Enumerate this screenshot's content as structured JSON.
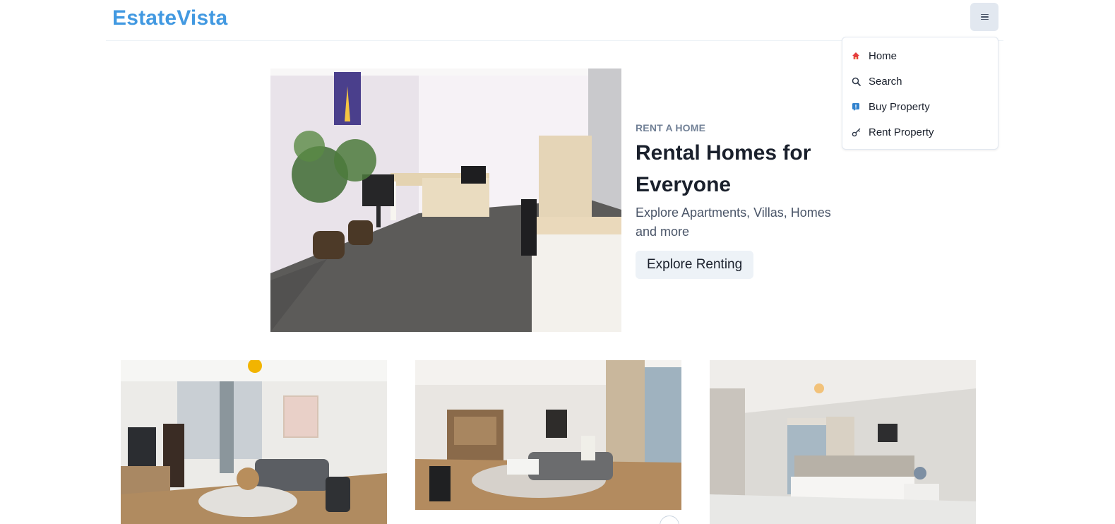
{
  "brand": {
    "name": "EstateVista",
    "color": "#4299e1"
  },
  "nav": {
    "menu_icon": "hamburger-icon",
    "items": [
      {
        "label": "Home",
        "icon": "home-icon"
      },
      {
        "label": "Search",
        "icon": "search-icon"
      },
      {
        "label": "Buy Property",
        "icon": "info-tag-icon"
      },
      {
        "label": "Rent Property",
        "icon": "key-icon"
      }
    ]
  },
  "hero": {
    "eyebrow": "RENT A HOME",
    "title": "Rental Homes for Everyone",
    "description": "Explore Apartments, Villas, Homes and more",
    "button_label": "Explore Renting",
    "image": "office-room-photo"
  },
  "listings": [
    {
      "image": "living-room-photo"
    },
    {
      "image": "apartment-lounge-photo"
    },
    {
      "image": "bedroom-photo"
    }
  ]
}
